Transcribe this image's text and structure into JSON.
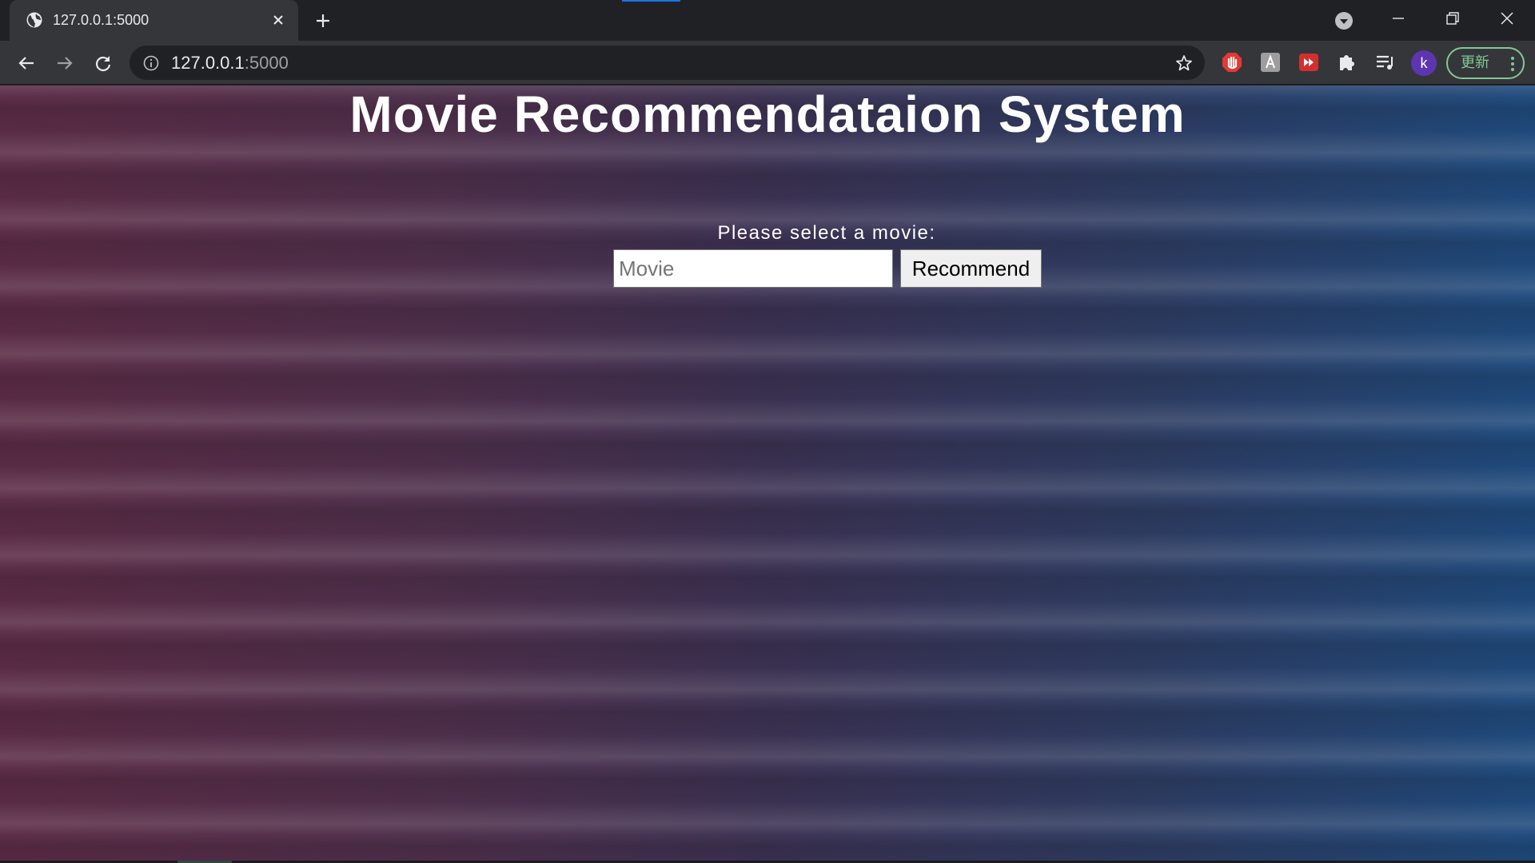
{
  "browser": {
    "tab": {
      "title": "127.0.0.1:5000",
      "favicon": "globe-icon"
    },
    "address_bar": {
      "host": "127.0.0.1",
      "port": ":5000"
    },
    "profile_initial": "k",
    "update_button_label": "更新",
    "colors": {
      "tab_strip": "#202124",
      "toolbar": "#35363a",
      "update_accent": "#81c995",
      "avatar": "#5e35b1"
    }
  },
  "page": {
    "title": "Movie Recommendataion System",
    "select_label": "Please select a movie:",
    "movie_input": {
      "value": "",
      "placeholder": "Movie"
    },
    "recommend_button_label": "Recommend"
  }
}
